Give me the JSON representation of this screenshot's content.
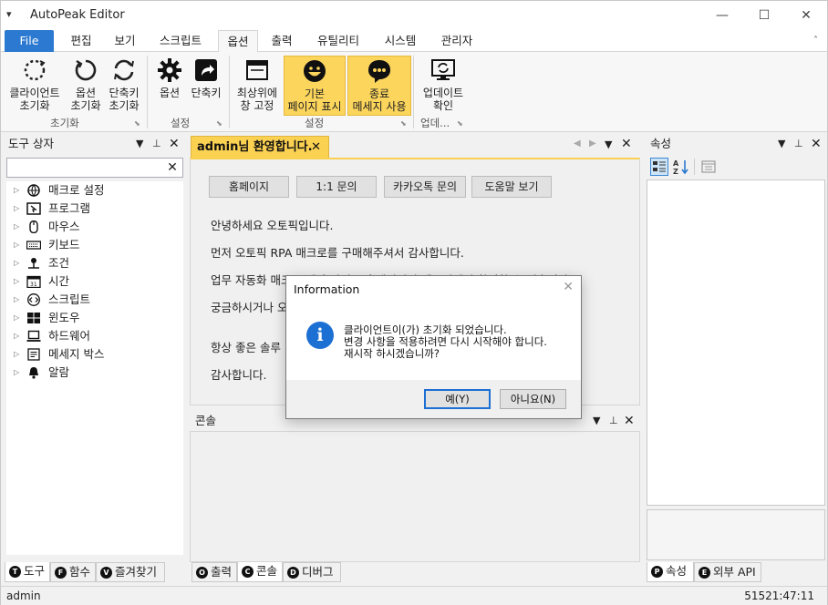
{
  "titlebar": {
    "menu_glyph": "▾",
    "title": "AutoPeak Editor",
    "minimize": "—",
    "maximize": "☐",
    "close": "✕"
  },
  "tabs": [
    {
      "label": "File"
    },
    {
      "label": "편집"
    },
    {
      "label": "보기"
    },
    {
      "label": "스크립트"
    },
    {
      "label": "옵션"
    },
    {
      "label": "출력"
    },
    {
      "label": "유틸리티"
    },
    {
      "label": "시스템"
    },
    {
      "label": "관리자"
    }
  ],
  "tab_collapse": "˄",
  "ribbon": {
    "buttons": [
      {
        "line1": "클라이언트",
        "line2": "초기화",
        "icon": "refresh-dashed-icon"
      },
      {
        "line1": "옵션",
        "line2": "초기화",
        "icon": "refresh-icon"
      },
      {
        "line1": "단축키",
        "line2": "초기화",
        "icon": "refresh-arrows-icon"
      },
      {
        "line1": "옵션",
        "line2": "",
        "icon": "gear-icon"
      },
      {
        "line1": "단축키",
        "line2": "",
        "icon": "shortcut-icon"
      },
      {
        "line1": "최상위에",
        "line2": "창 고정",
        "icon": "window-pin-icon"
      },
      {
        "line1": "기본",
        "line2": "페이지 표시",
        "icon": "smiley-icon"
      },
      {
        "line1": "종료",
        "line2": "메세지 사용",
        "icon": "chat-bubble-icon"
      },
      {
        "line1": "업데이트",
        "line2": "확인",
        "icon": "monitor-sync-icon"
      }
    ],
    "groups": {
      "init": "초기화",
      "settings": "설정",
      "settings2": "설정",
      "update": "업데..."
    }
  },
  "left_panel": {
    "title": "도구 상자",
    "search_clear": "✕",
    "items": [
      {
        "label": "매크로 설정",
        "icon": "globe-icon"
      },
      {
        "label": "프로그램",
        "icon": "program-icon"
      },
      {
        "label": "마우스",
        "icon": "mouse-icon"
      },
      {
        "label": "키보드",
        "icon": "keyboard-icon"
      },
      {
        "label": "조건",
        "icon": "condition-icon"
      },
      {
        "label": "시간",
        "icon": "calendar-icon"
      },
      {
        "label": "스크립트",
        "icon": "script-icon"
      },
      {
        "label": "윈도우",
        "icon": "windows-icon"
      },
      {
        "label": "하드웨어",
        "icon": "laptop-icon"
      },
      {
        "label": "메세지 박스",
        "icon": "message-box-icon"
      },
      {
        "label": "알람",
        "icon": "bell-icon"
      }
    ],
    "bottom_tabs": [
      {
        "letter": "T",
        "label": "도구"
      },
      {
        "letter": "F",
        "label": "함수"
      },
      {
        "letter": "V",
        "label": "즐겨찾기"
      }
    ]
  },
  "document": {
    "tab_title": "admin님 환영합니다.",
    "buttons": [
      "홈페이지",
      "1:1 문의",
      "카카오톡 문의",
      "도움말 보기"
    ],
    "lines": [
      "안녕하세요 오토픽입니다.",
      "먼저 오토픽 RPA 매크로를 구매해주셔서 감사합니다.",
      "업무 자동화 매크로 제작 방법은 홈페이지의 메뉴얼에서 확인할 수 있습니다.",
      "궁금하시거나 오",
      "항상 좋은 솔루",
      "감사합니다."
    ]
  },
  "console": {
    "title": "콘솔",
    "bottom_tabs": [
      {
        "letter": "O",
        "label": "출력"
      },
      {
        "letter": "C",
        "label": "콘솔"
      },
      {
        "letter": "D",
        "label": "디버그"
      }
    ]
  },
  "right_panel": {
    "title": "속성",
    "bottom_tabs": [
      {
        "letter": "P",
        "label": "속성"
      },
      {
        "letter": "E",
        "label": "외부 API"
      }
    ]
  },
  "status": {
    "user": "admin",
    "time": "51521:47:11"
  },
  "dialog": {
    "title": "Information",
    "icon": "i",
    "lines": [
      "클라이언트이(가) 초기화 되었습니다.",
      "변경 사항을 적용하려면 다시 시작해야 합니다.",
      "재시작 하시겠습니까?"
    ],
    "yes": "예(Y)",
    "no": "아니요(N)"
  },
  "colors": {
    "accent": "#2b79d0",
    "highlight": "#fcd55c",
    "info": "#1c6fd3"
  }
}
